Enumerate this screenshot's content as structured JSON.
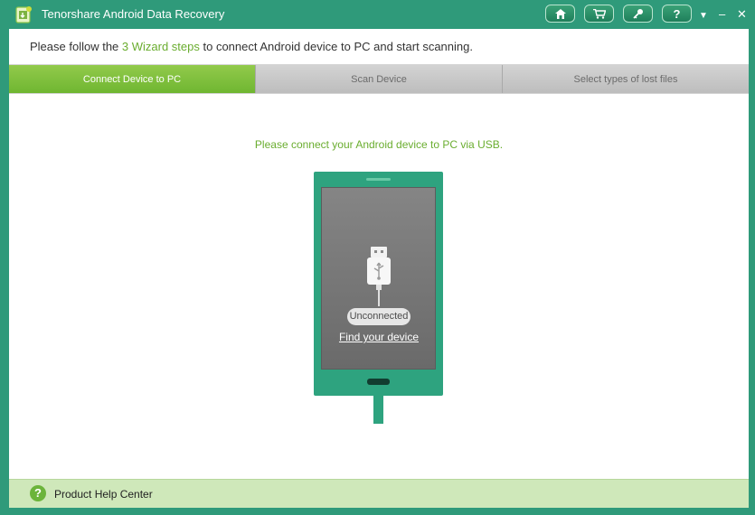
{
  "window": {
    "title": "Tenorshare Android Data Recovery",
    "buttons": [
      {
        "icon": "home-icon"
      },
      {
        "icon": "cart-icon"
      },
      {
        "icon": "key-icon"
      },
      {
        "icon": "help-icon",
        "label": "?"
      }
    ],
    "controls": {
      "menu": "▼",
      "minimize": "–",
      "close": "✕"
    }
  },
  "instruction": {
    "prefix": "Please follow the ",
    "highlight": "3 Wizard steps",
    "suffix": " to connect Android device to PC and start scanning."
  },
  "steps": [
    {
      "label": "Connect Device to PC",
      "active": true
    },
    {
      "label": "Scan Device",
      "active": false
    },
    {
      "label": "Select types of lost files",
      "active": false
    }
  ],
  "main": {
    "prompt": "Please connect your Android device to PC via USB.",
    "status_badge": "Unconnected",
    "find_link": "Find your device"
  },
  "footer": {
    "help_icon": "?",
    "label": "Product Help Center"
  },
  "colors": {
    "frame": "#2f9a7a",
    "accent_green": "#6aad2f",
    "phone": "#2ea37f",
    "footer_bg": "#cfe8ba"
  }
}
